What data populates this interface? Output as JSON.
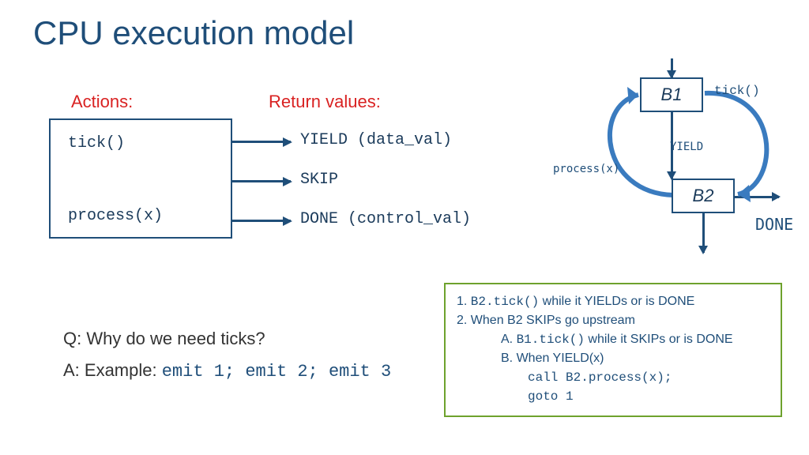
{
  "title": "CPU execution model",
  "headings": {
    "actions": "Actions:",
    "returns": "Return values:"
  },
  "actions": {
    "tick": "tick()",
    "process": "process(x)"
  },
  "return_values": {
    "yield": "YIELD (data_val)",
    "skip": "SKIP",
    "done": "DONE (control_val)"
  },
  "qa": {
    "q": "Q: Why do we need ticks?",
    "a_prefix": "A: Example: ",
    "a_code": "emit 1; emit 2; emit 3"
  },
  "diagram": {
    "nodes": {
      "b1": "B1",
      "b2": "B2"
    },
    "labels": {
      "tick": "tick()",
      "yield": "YIELD",
      "process": "process(x)",
      "done": "DONE"
    }
  },
  "algorithm": {
    "l1_pre": "1. ",
    "l1_code": "B2.tick()",
    "l1_post": "  while it YIELDs or is DONE",
    "l2": "2.   When B2 SKIPs go upstream",
    "l3_pre": "A. ",
    "l3_code": "B1.tick()",
    "l3_post": "  while it SKIPs or is DONE",
    "l4": "B.   When YIELD(x)",
    "l5": "call B2.process(x);",
    "l6": "goto 1"
  }
}
